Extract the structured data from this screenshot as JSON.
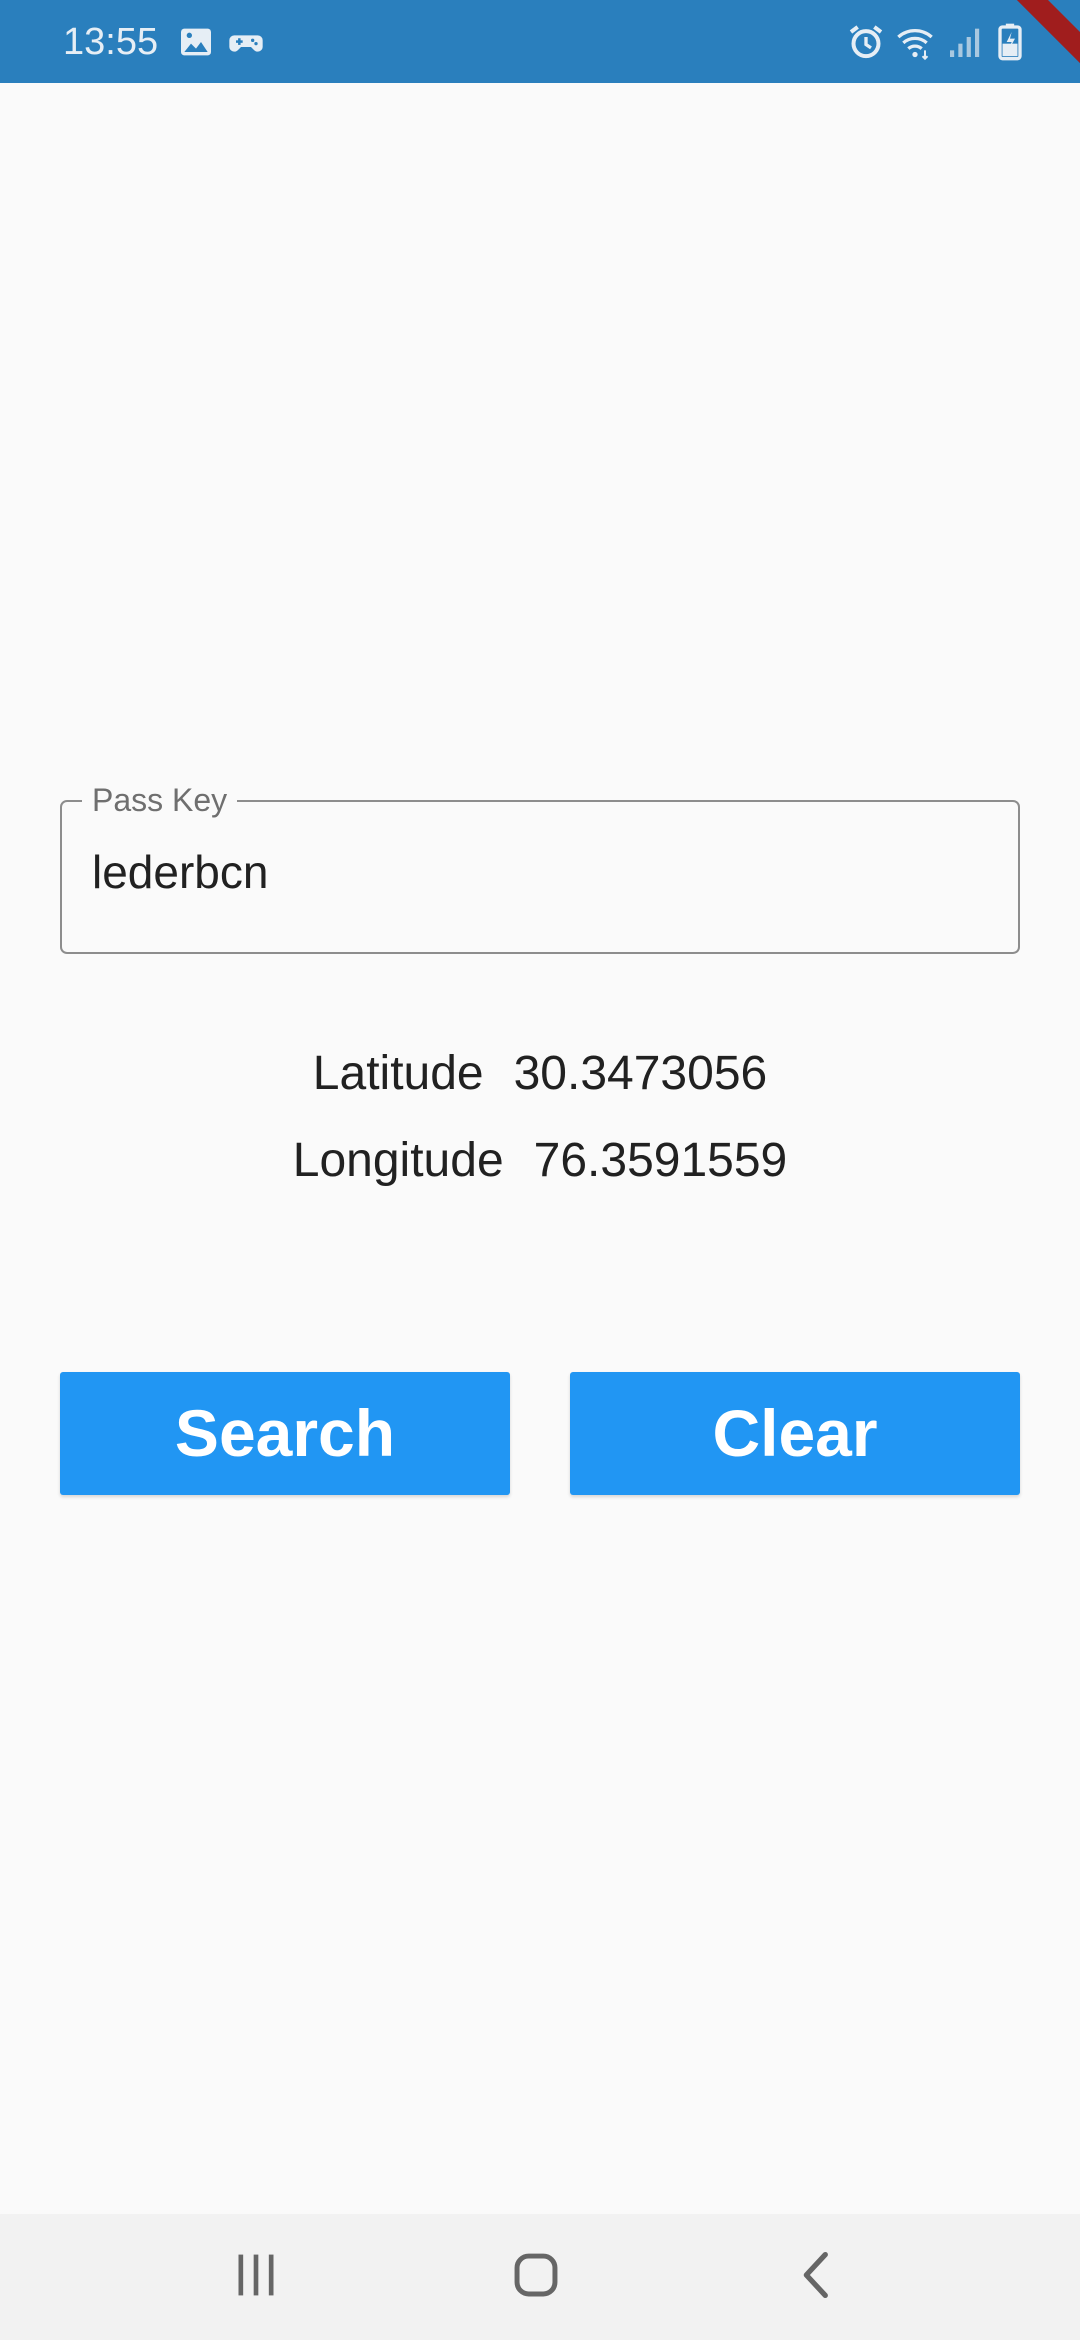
{
  "status_bar": {
    "time": "13:55",
    "background_color": "#2a7fbd",
    "left_icons": [
      "image-icon",
      "game-controller-icon"
    ],
    "right_icons": [
      "alarm-icon",
      "wifi-icon",
      "signal-icon",
      "battery-charging-icon"
    ]
  },
  "form": {
    "passkey_label": "Pass Key",
    "passkey_value": "lederbcn"
  },
  "coordinates": {
    "latitude_label": "Latitude",
    "latitude_value": "30.3473056",
    "longitude_label": "Longitude",
    "longitude_value": "76.3591559"
  },
  "actions": {
    "search_label": "Search",
    "clear_label": "Clear",
    "button_color": "#2196f3"
  },
  "nav_bar": {
    "icons": [
      "recent-apps-icon",
      "home-icon",
      "back-icon"
    ]
  }
}
